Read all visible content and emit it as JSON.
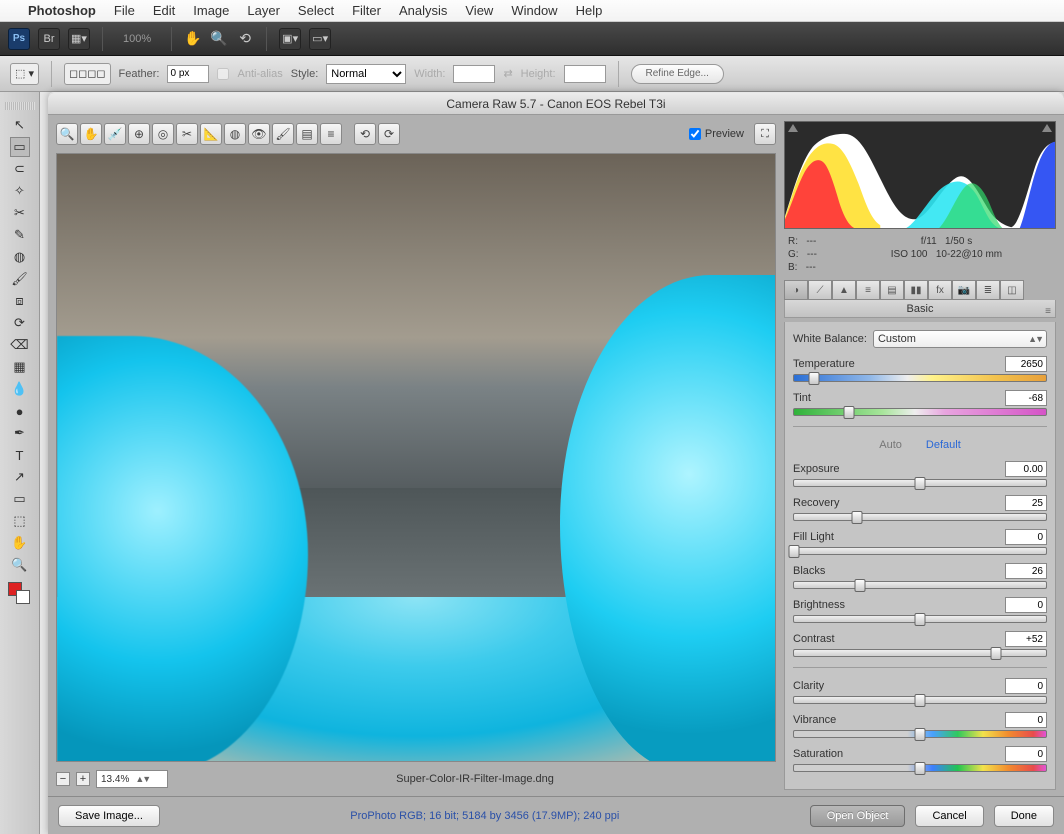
{
  "menubar": {
    "apple": "",
    "appname": "Photoshop",
    "items": [
      "File",
      "Edit",
      "Image",
      "Layer",
      "Select",
      "Filter",
      "Analysis",
      "View",
      "Window",
      "Help"
    ]
  },
  "toolbar1": {
    "zoom": "100%"
  },
  "toolbar2": {
    "feather_label": "Feather:",
    "feather_value": "0 px",
    "antialias": "Anti-alias",
    "style_label": "Style:",
    "style_value": "Normal",
    "width_label": "Width:",
    "height_label": "Height:",
    "refine": "Refine Edge..."
  },
  "camera_raw": {
    "title": "Camera Raw 5.7  -  Canon EOS Rebel T3i",
    "preview_label": "Preview",
    "zoom": "13.4%",
    "filename": "Super-Color-IR-Filter-Image.dng",
    "info": "ProPhoto RGB; 16 bit; 5184 by 3456 (17.9MP); 240 ppi",
    "buttons": {
      "save": "Save Image...",
      "open": "Open Object",
      "cancel": "Cancel",
      "done": "Done"
    },
    "exif": {
      "r": "R:",
      "g": "G:",
      "b": "B:",
      "dash": "---",
      "aperture": "f/11",
      "shutter": "1/50 s",
      "iso": "ISO 100",
      "lens": "10-22@10 mm"
    },
    "panel_title": "Basic",
    "wb_label": "White Balance:",
    "wb_value": "Custom",
    "auto": "Auto",
    "default": "Default",
    "sliders": {
      "temperature": {
        "label": "Temperature",
        "value": "2650",
        "pos": 8,
        "track": "track-temp"
      },
      "tint": {
        "label": "Tint",
        "value": "-68",
        "pos": 22,
        "track": "track-tint"
      },
      "exposure": {
        "label": "Exposure",
        "value": "0.00",
        "pos": 50,
        "track": "track-plain"
      },
      "recovery": {
        "label": "Recovery",
        "value": "25",
        "pos": 25,
        "track": "track-plain"
      },
      "fill": {
        "label": "Fill Light",
        "value": "0",
        "pos": 0,
        "track": "track-plain"
      },
      "blacks": {
        "label": "Blacks",
        "value": "26",
        "pos": 26,
        "track": "track-plain"
      },
      "brightness": {
        "label": "Brightness",
        "value": "0",
        "pos": 50,
        "track": "track-plain"
      },
      "contrast": {
        "label": "Contrast",
        "value": "+52",
        "pos": 80,
        "track": "track-plain"
      },
      "clarity": {
        "label": "Clarity",
        "value": "0",
        "pos": 50,
        "track": "track-clar"
      },
      "vibrance": {
        "label": "Vibrance",
        "value": "0",
        "pos": 50,
        "track": "track-vib"
      },
      "saturation": {
        "label": "Saturation",
        "value": "0",
        "pos": 50,
        "track": "track-sat"
      }
    }
  },
  "left_tools": [
    "↖",
    "▭",
    "◯",
    "✧",
    "▤",
    "✄",
    "✎",
    "◌",
    "✐",
    "⌫",
    "▦",
    "⬤",
    "⬣",
    "◐",
    "●",
    "⊙",
    "✎",
    "╲",
    "⬚",
    "T",
    "↗",
    "▭",
    "◯",
    "✋",
    "🔍",
    "⊕"
  ]
}
